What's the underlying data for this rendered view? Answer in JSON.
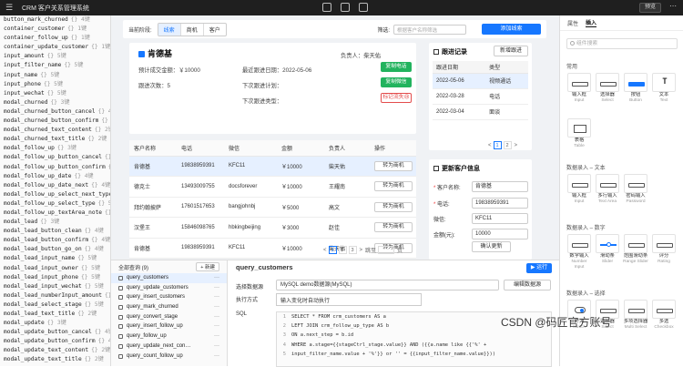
{
  "topbar": {
    "menu_icon": "hamburger-icon",
    "title": "CRM 客户关系管理系统",
    "preview_label": "预览",
    "more_icon": "ellipsis-icon"
  },
  "variables": [
    {
      "name": "button_mark_churned",
      "count": "{} 4键"
    },
    {
      "name": "container_customer",
      "count": "{} 1键"
    },
    {
      "name": "container_follow_up",
      "count": "{} 1键"
    },
    {
      "name": "container_update_customer",
      "count": "{} 1键"
    },
    {
      "name": "input_amount",
      "count": "{} 5键"
    },
    {
      "name": "input_filter_name",
      "count": "{} 5键"
    },
    {
      "name": "input_name",
      "count": "{} 5键"
    },
    {
      "name": "input_phone",
      "count": "{} 5键"
    },
    {
      "name": "input_wechat",
      "count": "{} 5键"
    },
    {
      "name": "modal_churned",
      "count": "{} 3键"
    },
    {
      "name": "modal_churned_button_cancel",
      "count": "{} 4键"
    },
    {
      "name": "modal_churned_button_confirm",
      "count": "{} 4键"
    },
    {
      "name": "modal_churned_text_content",
      "count": "{} 2键"
    },
    {
      "name": "modal_churned_text_title",
      "count": "{} 2键"
    },
    {
      "name": "modal_follow_up",
      "count": "{} 3键"
    },
    {
      "name": "modal_follow_up_button_cancel",
      "count": "{} 4键"
    },
    {
      "name": "modal_follow_up_button_confirm",
      "count": "{} 4键"
    },
    {
      "name": "modal_follow_up_date",
      "count": "{} 4键"
    },
    {
      "name": "modal_follow_up_date_next",
      "count": "{} 4键"
    },
    {
      "name": "modal_follow_up_select_next_type",
      "count": ""
    },
    {
      "name": "modal_follow_up_select_type",
      "count": "{} 5键"
    },
    {
      "name": "modal_follow_up_textArea_note",
      "count": "{} 5键"
    },
    {
      "name": "modal_lead",
      "count": "{} 3键"
    },
    {
      "name": "modal_lead_button_clean",
      "count": "{} 4键"
    },
    {
      "name": "modal_lead_button_confirm",
      "count": "{} 4键"
    },
    {
      "name": "modal_lead_button_go_on",
      "count": "{} 4键"
    },
    {
      "name": "modal_lead_input_name",
      "count": "{} 5键"
    },
    {
      "name": "modal_lead_input_owner",
      "count": "{} 5键"
    },
    {
      "name": "modal_lead_input_phone",
      "count": "{} 5键"
    },
    {
      "name": "modal_lead_input_wechat",
      "count": "{} 5键"
    },
    {
      "name": "modal_lead_numberInput_amount",
      "count": "{} 5键"
    },
    {
      "name": "modal_lead_select_stage",
      "count": "{} 5键"
    },
    {
      "name": "modal_lead_text_title",
      "count": "{} 2键"
    },
    {
      "name": "modal_update",
      "count": "{} 3键"
    },
    {
      "name": "modal_update_button_cancel",
      "count": "{} 4键"
    },
    {
      "name": "modal_update_button_confirm",
      "count": "{} 4键"
    },
    {
      "name": "modal_update_text_content",
      "count": "{} 2键"
    },
    {
      "name": "modal_update_text_title",
      "count": "{} 2键"
    }
  ],
  "filter": {
    "stage_label": "当前阶段:",
    "tabs": [
      "线索",
      "商机",
      "客户"
    ],
    "search_label": "筛选:",
    "search_placeholder": "根据客户名称筛选",
    "add_label": "添加线索"
  },
  "customer": {
    "name": "肯德基",
    "owner": "负责人：柴天佑",
    "expected": "预计成交金额：￥10000",
    "recent_date": "最近跟进日期：2022-05-06",
    "count": "跟进次数：5",
    "next_plan": "下次跟进计划：",
    "next_type": "下次跟进类型：",
    "copy_phone": "复制电话",
    "copy_wechat": "复制微信",
    "mark_churned": "标记流失😢"
  },
  "follow": {
    "title": "跟进记录",
    "new_label": "新增跟进",
    "columns": [
      "跟进日期",
      "类型"
    ],
    "rows": [
      [
        "2022-05-06",
        "视频通话"
      ],
      [
        "2022-03-28",
        "电话"
      ],
      [
        "2022-03-04",
        "面谈"
      ]
    ],
    "pager": {
      "prev": "<",
      "page": "1",
      "page2": "2",
      "next": ">"
    }
  },
  "list": {
    "columns": [
      "客户名称",
      "电话",
      "微信",
      "金额",
      "负责人",
      "操作"
    ],
    "rows": [
      [
        "肯德基",
        "19838959391",
        "KFC11",
        "￥10000",
        "柴天佑",
        "转为商机"
      ],
      [
        "德克士",
        "13493009755",
        "docsforever",
        "￥10000",
        "王耀南",
        "转为商机"
      ],
      [
        "拜约翰披萨",
        "17601517653",
        "bangjohnbj",
        "￥5000",
        "高文",
        "转为商机"
      ],
      [
        "汉堡王",
        "15846098765",
        "hbkingbeijing",
        "￥3000",
        "赵佳",
        "转为商机"
      ],
      [
        "肯德基",
        "19838959391",
        "KFC11",
        "￥10000",
        "柴天佑",
        "转为商机"
      ]
    ],
    "pager": {
      "prev": "<",
      "p1": "1",
      "p2": "2",
      "p3": "3",
      "next": ">",
      "jump": "跳至",
      "unit": "页"
    }
  },
  "update": {
    "title": "更新客户信息",
    "fields": [
      {
        "label": "客户名称:",
        "value": "肯德基",
        "required": true
      },
      {
        "label": "电话:",
        "value": "19838959391",
        "required": true
      },
      {
        "label": "微信:",
        "value": "KFC11",
        "required": false
      },
      {
        "label": "金额(元):",
        "value": "10000",
        "required": false
      }
    ],
    "button": "确认更新"
  },
  "queries": {
    "header": "全部查询 (9)",
    "new_label": "+ 新建",
    "items": [
      "query_customers",
      "query_update_customers",
      "query_insert_customers",
      "query_mark_churned",
      "query_convert_stage",
      "query_insert_follow_up",
      "query_follow_up",
      "query_update_next_con…",
      "query_count_follow_up"
    ],
    "more_icon": "···"
  },
  "editor": {
    "title": "query_customers",
    "run_label": "▶ 运行",
    "source_label": "选择数据源",
    "source_value": "MySQL demo数据源(MySQL)",
    "edit_source": "编辑数据源",
    "exec_label": "执行方式",
    "exec_value": "输入变化时自动执行",
    "sql_label": "SQL",
    "lines": [
      "SELECT * FROM crm_customers AS a",
      "LEFT JOIN crm_follow_up_type AS b",
      "ON a.next_step = b.id",
      "WHERE a.stage={{stageCtrl_stage.value}} AND ({{a.name like {{'%' +",
      "input_filter_name.value + '%'}} or '' = {{input_filter_name.value}}))"
    ]
  },
  "rpanel": {
    "tabs": [
      "属性",
      "插入"
    ],
    "search_placeholder": "组件搜索",
    "groups": [
      {
        "title": "常用",
        "items": [
          [
            "输入框",
            "Input"
          ],
          [
            "选择器",
            "Select"
          ],
          [
            "按钮",
            "Button"
          ],
          [
            "文本",
            "Text"
          ],
          [
            "表格",
            "Table"
          ]
        ]
      },
      {
        "title": "数据录入 – 文本",
        "items": [
          [
            "输入框",
            "Input"
          ],
          [
            "多行输入",
            "Text Area"
          ],
          [
            "密码输入",
            "Password"
          ]
        ]
      },
      {
        "title": "数据录入 – 数字",
        "items": [
          [
            "数字输入",
            "Number Input"
          ],
          [
            "滑动条",
            "Slider"
          ],
          [
            "范围滑动条",
            "Range Slider"
          ],
          [
            "评分",
            "Rating"
          ]
        ]
      },
      {
        "title": "数据录入 – 选择",
        "items": [
          [
            "开关",
            "Switch"
          ],
          [
            "选择器",
            "Select"
          ],
          [
            "多项选择器",
            "Multi Select"
          ],
          [
            "多选",
            "Checkbox"
          ]
        ]
      }
    ]
  },
  "watermark": "CSDN @码匠官方账号"
}
